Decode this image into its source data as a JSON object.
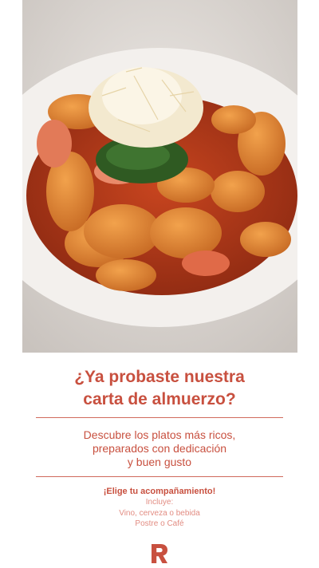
{
  "photo": {
    "alt_icon": "gnocchi-dish-photo"
  },
  "headline": {
    "line1": "¿Ya probaste nuestra",
    "line2": "carta de almuerzo?"
  },
  "description": {
    "line1": "Descubre los platos más ricos,",
    "line2": "preparados con dedicación",
    "line3": "y buen gusto"
  },
  "cta": "¡Elige tu acompañamiento!",
  "includes": {
    "title": "Incluye:",
    "item1": "Vino, cerveza o bebida",
    "item2": "Postre o Café"
  },
  "brand": {
    "logo_icon": "r-logo-icon",
    "color": "#c8503f"
  }
}
